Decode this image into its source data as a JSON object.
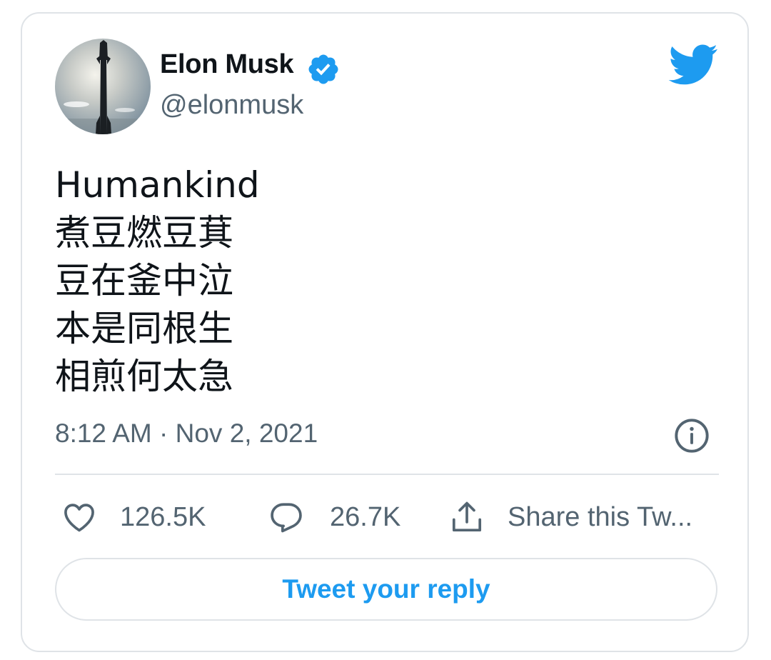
{
  "author": {
    "name": "Elon Musk",
    "handle": "@elonmusk",
    "verified": true,
    "avatar_icon": "starship-rocket-avatar"
  },
  "brand": {
    "logo_icon": "twitter-bird-icon",
    "accent_color": "#1d9bf0"
  },
  "tweet": {
    "lines": [
      "Humankind",
      "煮豆燃豆萁",
      "豆在釜中泣",
      "本是同根生",
      "相煎何太急"
    ],
    "timestamp": "8:12 AM · Nov 2, 2021"
  },
  "actions": {
    "like_count": "126.5K",
    "reply_count": "26.7K",
    "share_label": "Share this Tw..."
  },
  "reply_button_label": "Tweet your reply"
}
